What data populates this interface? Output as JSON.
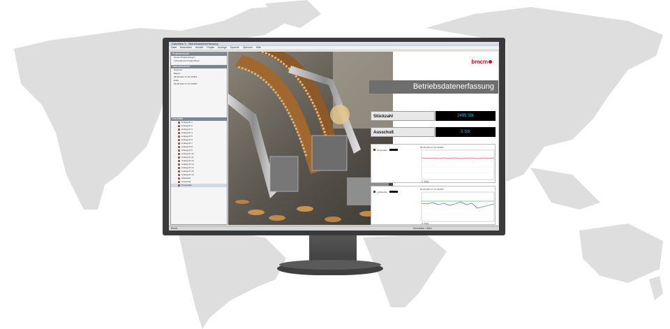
{
  "app": {
    "title": "DataView X - Betriebsdatenerfassung",
    "menu": [
      "Datei",
      "Bearbeiten",
      "Ansicht",
      "Projekt",
      "Anzeige",
      "Sprache",
      "Optionen",
      "Hilfe"
    ]
  },
  "left_panel": {
    "top_header": "Projektauswahl",
    "items": [
      "Neues Projekt anlegen",
      "Vorhandenes Projekt öffnen"
    ],
    "section_header": "Datenaufnahme",
    "fields": [
      "Optionen",
      "Beginn",
      "Ende"
    ],
    "dates": [
      "06.06.2013 17:26:40.861",
      "06.06.2013 17:27:44.807"
    ],
    "tree_header": "Kanalliste",
    "tree_items": [
      "Analog-IN 1",
      "Analog-IN 2",
      "Analog-IN 3",
      "Analog-IN 4",
      "Analog-IN 5",
      "Analog-IN 6",
      "Analog-IN 7",
      "Analog-IN 8",
      "Analog-IN 9",
      "Analog-IN 10",
      "Analog-IN 11",
      "Analog-IN 12",
      "Analog-IN 13",
      "Analog-IN 14",
      "Analog-IN 15",
      "Analog-IN 16",
      "Stückzahl",
      "Ausschuß",
      "Temperatur"
    ]
  },
  "dashboard": {
    "logo": "bmcm",
    "banner": "Betriebsdatenerfassung",
    "kpis": [
      {
        "label": "Stückzahl",
        "value": "2495 Stk"
      },
      {
        "label": "Ausschuß",
        "value": "5  Stk"
      }
    ],
    "charts": [
      {
        "header": "06.06.2013 17:27:36.860",
        "legend": "Temperatur",
        "readout": "X: 30[s]"
      },
      {
        "header": "06.06.2013 17:27:36.860",
        "legend": "Luftfeuchte",
        "readout": "X: 30[s]"
      }
    ]
  },
  "status": {
    "text": "Bereit",
    "right": "Simulation / Aktiv"
  },
  "colors": {
    "accent": "#d0101c",
    "kpi_value": "#19b6ff",
    "banner": "#6e6e6e",
    "map": "#dcdcdc"
  }
}
